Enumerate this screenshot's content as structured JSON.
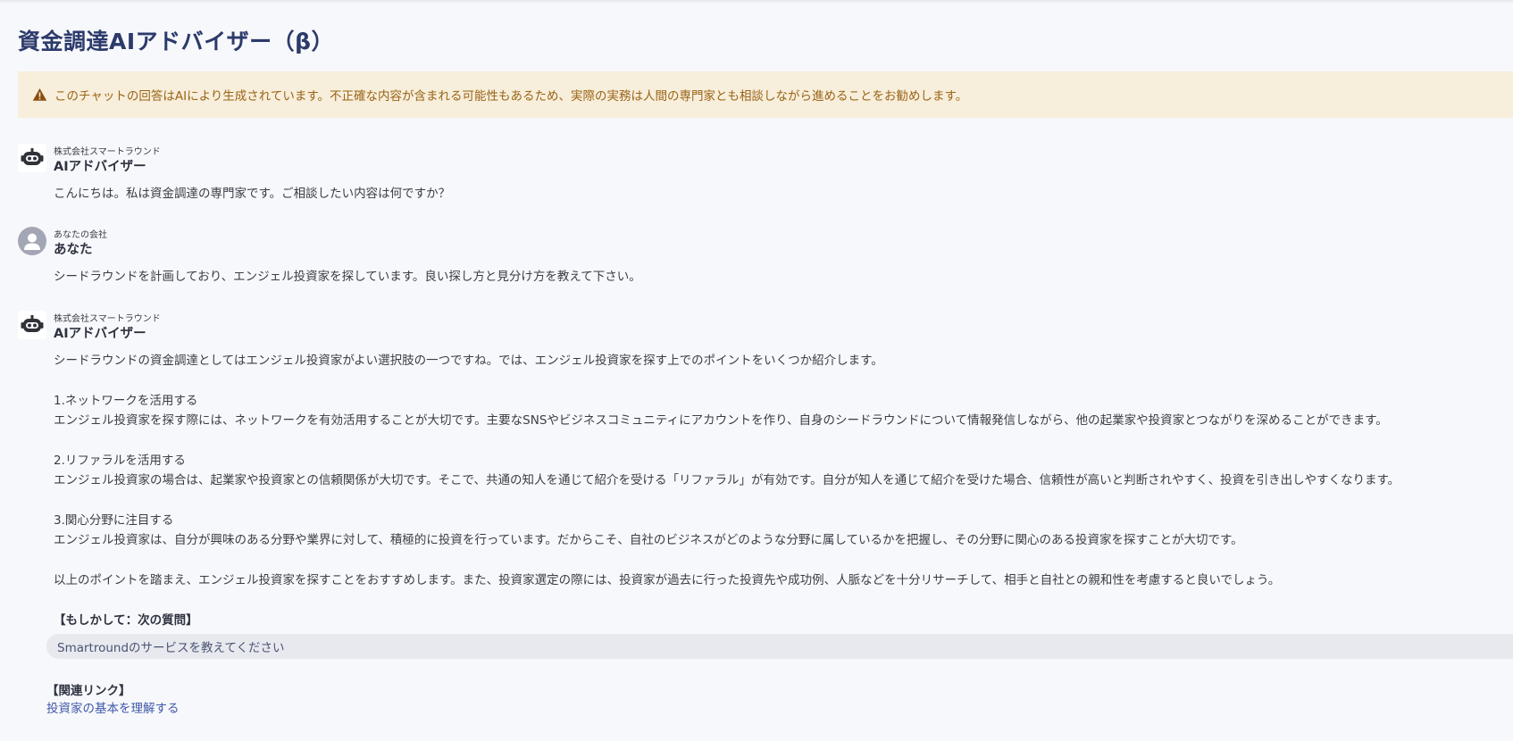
{
  "header": {
    "title": "資金調達AIアドバイザー（β）"
  },
  "warning": {
    "icon": "warning-icon",
    "text": "このチャットの回答はAIにより生成されています。不正確な内容が含まれる可能性もあるため、実際の実務は人間の専門家とも相談しながら進めることをお勧めします。"
  },
  "messages": [
    {
      "avatar_icon": "robot-icon",
      "company": "株式会社スマートラウンド",
      "sender": "AIアドバイザー",
      "lines": [
        "こんにちは。私は資金調達の専門家です。ご相談したい内容は何ですか？"
      ]
    },
    {
      "avatar_icon": "user-icon",
      "company": "あなたの会社",
      "sender": "あなた",
      "lines": [
        "シードラウンドを計画しており、エンジェル投資家を探しています。良い探し方と見分け方を教えて下さい。"
      ]
    },
    {
      "avatar_icon": "robot-icon",
      "company": "株式会社スマートラウンド",
      "sender": "AIアドバイザー",
      "lines": [
        "シードラウンドの資金調達としてはエンジェル投資家がよい選択肢の一つですね。では、エンジェル投資家を探す上でのポイントをいくつか紹介します。",
        "1.ネットワークを活用する",
        "エンジェル投資家を探す際には、ネットワークを有効活用することが大切です。主要なSNSやビジネスコミュニティにアカウントを作り、自身のシードラウンドについて情報発信しながら、他の起業家や投資家とつながりを深めることができます。",
        "2.リファラルを活用する",
        "エンジェル投資家の場合は、起業家や投資家との信頼関係が大切です。そこで、共通の知人を通じて紹介を受ける「リファラル」が有効です。自分が知人を通じて紹介を受けた場合、信頼性が高いと判断されやすく、投資を引き出しやすくなります。",
        "3.関心分野に注目する",
        "エンジェル投資家は、自分が興味のある分野や業界に対して、積極的に投資を行っています。だからこそ、自社のビジネスがどのような分野に属しているかを把握し、その分野に関心のある投資家を探すことが大切です。",
        "以上のポイントを踏まえ、エンジェル投資家を探すことをおすすめします。また、投資家選定の際には、投資家が過去に行った投資先や成功例、人脈などを十分リサーチして、相手と自社との親和性を考慮すると良いでしょう。"
      ],
      "suggest_label": "【もしかして：次の質問】",
      "suggest_button": "Smartroundのサービスを教えてください",
      "links_label": "【関連リンク】",
      "link_text": "投資家の基本を理解する"
    }
  ]
}
